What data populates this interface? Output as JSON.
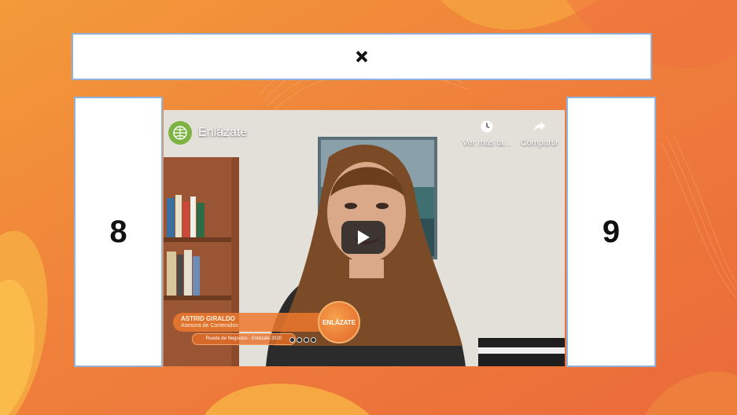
{
  "close_bar": {
    "icon": "close-icon"
  },
  "side_panels": {
    "left_label": "8",
    "right_label": "9"
  },
  "video": {
    "channel_name": "Enlázate",
    "watch_later_label": "Ver más ta...",
    "share_label": "Compartir",
    "lower_third_name": "ASTRID GIRALDO",
    "lower_third_role": "Asesora de Contenidos",
    "lower_third_pill": "Rueda de Negocios - Enlázate 2020",
    "badge_text": "ENLÁZATE"
  },
  "colors": {
    "background": "#f0913a",
    "panel_border": "#8fb3de",
    "panel_fill": "#ffffff",
    "play_button": "#212121"
  }
}
